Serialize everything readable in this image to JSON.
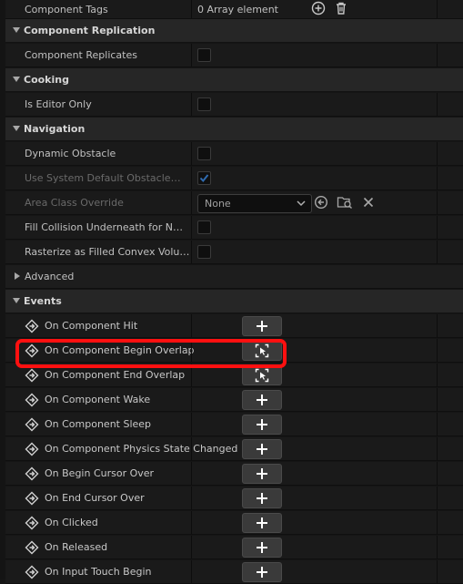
{
  "component_tags": {
    "label": "Component Tags",
    "value": "0 Array element",
    "add_icon": "plus-circle-icon",
    "delete_icon": "trash-icon"
  },
  "sections": {
    "replication": {
      "title": "Component Replication",
      "replicates_label": "Component Replicates",
      "replicates_checked": false
    },
    "cooking": {
      "title": "Cooking",
      "editor_only_label": "Is Editor Only",
      "editor_only_checked": false
    },
    "navigation": {
      "title": "Navigation",
      "dynamic_obstacle_label": "Dynamic Obstacle",
      "dynamic_obstacle_checked": false,
      "system_default_label": "Use System Default Obstacle Ar...",
      "system_default_checked": true,
      "area_class_label": "Area Class Override",
      "area_class_value": "None",
      "fill_collision_label": "Fill Collision Underneath for Nav...",
      "fill_collision_checked": false,
      "rasterize_label": "Rasterize as Filled Convex Volume",
      "rasterize_checked": false
    },
    "advanced": {
      "title": "Advanced"
    },
    "events": {
      "title": "Events",
      "items": [
        {
          "label": "On Component Hit",
          "button": "add"
        },
        {
          "label": "On Component Begin Overlap",
          "button": "goto"
        },
        {
          "label": "On Component End Overlap",
          "button": "goto"
        },
        {
          "label": "On Component Wake",
          "button": "add"
        },
        {
          "label": "On Component Sleep",
          "button": "add"
        },
        {
          "label": "On Component Physics State Changed",
          "button": "add"
        },
        {
          "label": "On Begin Cursor Over",
          "button": "add"
        },
        {
          "label": "On End Cursor Over",
          "button": "add"
        },
        {
          "label": "On Clicked",
          "button": "add"
        },
        {
          "label": "On Released",
          "button": "add"
        },
        {
          "label": "On Input Touch Begin",
          "button": "add"
        }
      ]
    }
  },
  "colors": {
    "highlight": "#ff1010",
    "check": "#2f6bb0",
    "panel": "#1a1a1a",
    "category": "#262626"
  }
}
